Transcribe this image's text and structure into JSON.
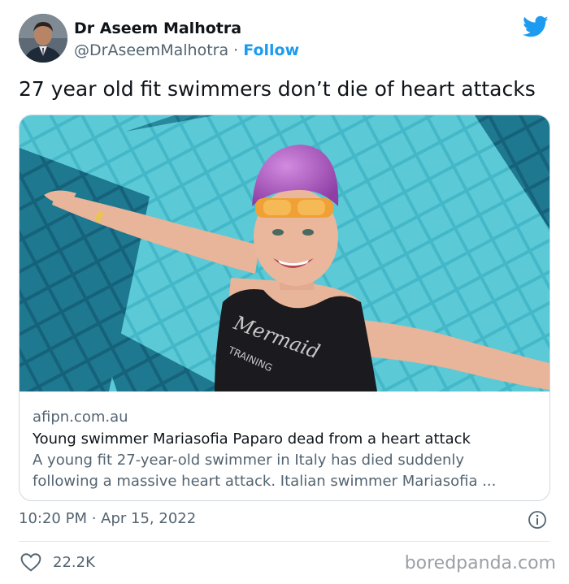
{
  "author": {
    "display_name": "Dr Aseem Malhotra",
    "handle": "@DrAseemMalhotra",
    "separator": " · ",
    "follow_label": "Follow"
  },
  "tweet": {
    "text": "27 year old fit swimmers don’t die of heart attacks"
  },
  "card": {
    "domain": "afipn.com.au",
    "title": "Young swimmer Mariasofia Paparo dead from a heart attack",
    "description_line1": "A young fit 27-year-old swimmer in Italy has died suddenly",
    "description_line2": "following a massive heart attack. Italian swimmer Mariasofia ...",
    "image_swimsuit_text_1": "Mermaid",
    "image_swimsuit_text_2": "TRAINING"
  },
  "meta": {
    "time": "10:20 PM",
    "separator": " · ",
    "date": "Apr 15, 2022"
  },
  "actions": {
    "like_count": "22.2K"
  },
  "watermark": {
    "text": "boredpanda.com"
  },
  "icons": {
    "twitter": "twitter-bird-icon",
    "info": "info-icon",
    "like": "heart-icon"
  },
  "colors": {
    "accent": "#1d9bf0",
    "secondary_text": "#536471",
    "primary_text": "#0f1419",
    "pool": "#3fb3c2"
  }
}
